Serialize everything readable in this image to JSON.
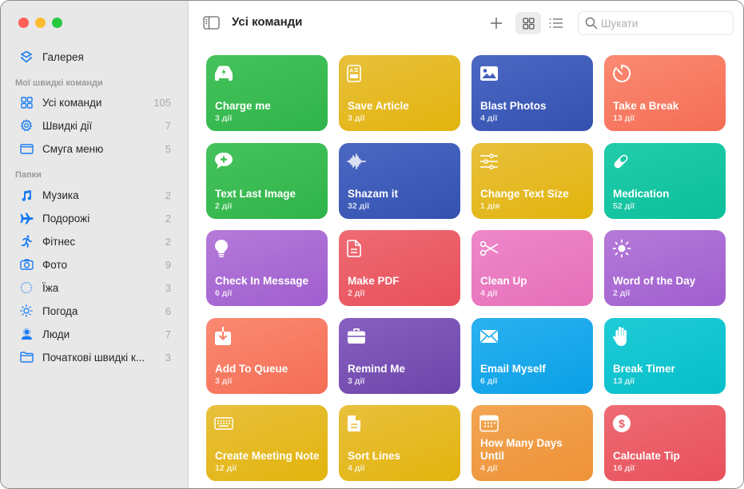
{
  "window": {
    "title": "Усі команди"
  },
  "sidebar": {
    "gallery": {
      "label": "Галерея",
      "icon": "gallery-layers-icon"
    },
    "section_my": "Мої швидкі команди",
    "my_items": [
      {
        "label": "Усі команди",
        "count": "105",
        "icon": "grid-icon"
      },
      {
        "label": "Швидкі дії",
        "count": "7",
        "icon": "gear-icon"
      },
      {
        "label": "Смуга меню",
        "count": "5",
        "icon": "menubar-icon"
      }
    ],
    "section_folders": "Папки",
    "folders": [
      {
        "label": "Музика",
        "count": "2",
        "icon": "music-note-icon"
      },
      {
        "label": "Подорожі",
        "count": "2",
        "icon": "airplane-icon"
      },
      {
        "label": "Фітнес",
        "count": "2",
        "icon": "runner-icon"
      },
      {
        "label": "Фото",
        "count": "9",
        "icon": "camera-icon"
      },
      {
        "label": "Їжа",
        "count": "3",
        "icon": "food-circle-icon"
      },
      {
        "label": "Погода",
        "count": "6",
        "icon": "sun-icon"
      },
      {
        "label": "Люди",
        "count": "7",
        "icon": "person-icon"
      },
      {
        "label": "Початкові швидкі к...",
        "count": "3",
        "icon": "folder-icon"
      }
    ]
  },
  "toolbar": {
    "title": "Усі команди",
    "add_icon": "plus-icon",
    "grid_view_icon": "grid-view-icon",
    "list_view_icon": "list-view-icon",
    "search_placeholder": "Шукати",
    "search_value": ""
  },
  "shortcuts": [
    {
      "name": "Charge me",
      "count": "3 дії",
      "icon": "car-charge-icon",
      "colors": [
        "#46c35c",
        "#2fb44a"
      ]
    },
    {
      "name": "Save Article",
      "count": "3 дії",
      "icon": "article-icon",
      "colors": [
        "#e8c03c",
        "#e2b40d"
      ]
    },
    {
      "name": "Blast Photos",
      "count": "4 дії",
      "icon": "photo-icon",
      "colors": [
        "#4b68c3",
        "#3451b0"
      ]
    },
    {
      "name": "Take a Break",
      "count": "13 дії",
      "icon": "timer-icon",
      "colors": [
        "#fa8a72",
        "#f56d55"
      ]
    },
    {
      "name": "Text Last Image",
      "count": "2 дії",
      "icon": "message-plus-icon",
      "colors": [
        "#46c35c",
        "#2fb44a"
      ]
    },
    {
      "name": "Shazam it",
      "count": "32 дії",
      "icon": "waveform-icon",
      "colors": [
        "#4b68c3",
        "#3451b0"
      ]
    },
    {
      "name": "Change Text Size",
      "count": "1 дія",
      "icon": "sliders-icon",
      "colors": [
        "#e8c03c",
        "#e2b40d"
      ]
    },
    {
      "name": "Medication",
      "count": "52 дії",
      "icon": "pill-icon",
      "colors": [
        "#22ccaa",
        "#0cbf9b"
      ]
    },
    {
      "name": "Check In Message",
      "count": "6 дії",
      "icon": "lightbulb-icon",
      "colors": [
        "#b57ad9",
        "#9f5ecf"
      ]
    },
    {
      "name": "Make PDF",
      "count": "2 дії",
      "icon": "document-icon",
      "colors": [
        "#ee6b73",
        "#e8505b"
      ]
    },
    {
      "name": "Clean Up",
      "count": "4 дії",
      "icon": "scissors-icon",
      "colors": [
        "#ee88c9",
        "#e56fb9"
      ]
    },
    {
      "name": "Word of the Day",
      "count": "2 дії",
      "icon": "sun-icon",
      "colors": [
        "#b57ad9",
        "#9f5ecf"
      ]
    },
    {
      "name": "Add To Queue",
      "count": "3 дії",
      "icon": "tray-download-icon",
      "colors": [
        "#fa8a72",
        "#f56d55"
      ]
    },
    {
      "name": "Remind Me",
      "count": "3 дії",
      "icon": "briefcase-icon",
      "colors": [
        "#8760c0",
        "#6d45aa"
      ]
    },
    {
      "name": "Email Myself",
      "count": "6 дії",
      "icon": "envelope-icon",
      "colors": [
        "#2bb1f0",
        "#0aa0e6"
      ]
    },
    {
      "name": "Break Timer",
      "count": "13 дії",
      "icon": "hand-icon",
      "colors": [
        "#1fcbd6",
        "#06bfca"
      ]
    },
    {
      "name": "Create Meeting Note",
      "count": "12 дії",
      "icon": "keyboard-icon",
      "colors": [
        "#e8c03c",
        "#e2b40d"
      ]
    },
    {
      "name": "Sort Lines",
      "count": "4 дії",
      "icon": "doc-lines-icon",
      "colors": [
        "#e8c03c",
        "#e2b40d"
      ]
    },
    {
      "name": "How Many Days Until",
      "count": "4 дії",
      "icon": "calendar-icon",
      "colors": [
        "#f2a552",
        "#ef9238"
      ]
    },
    {
      "name": "Calculate Tip",
      "count": "16 дії",
      "icon": "dollar-icon",
      "colors": [
        "#ee6b73",
        "#e8505b"
      ]
    }
  ]
}
